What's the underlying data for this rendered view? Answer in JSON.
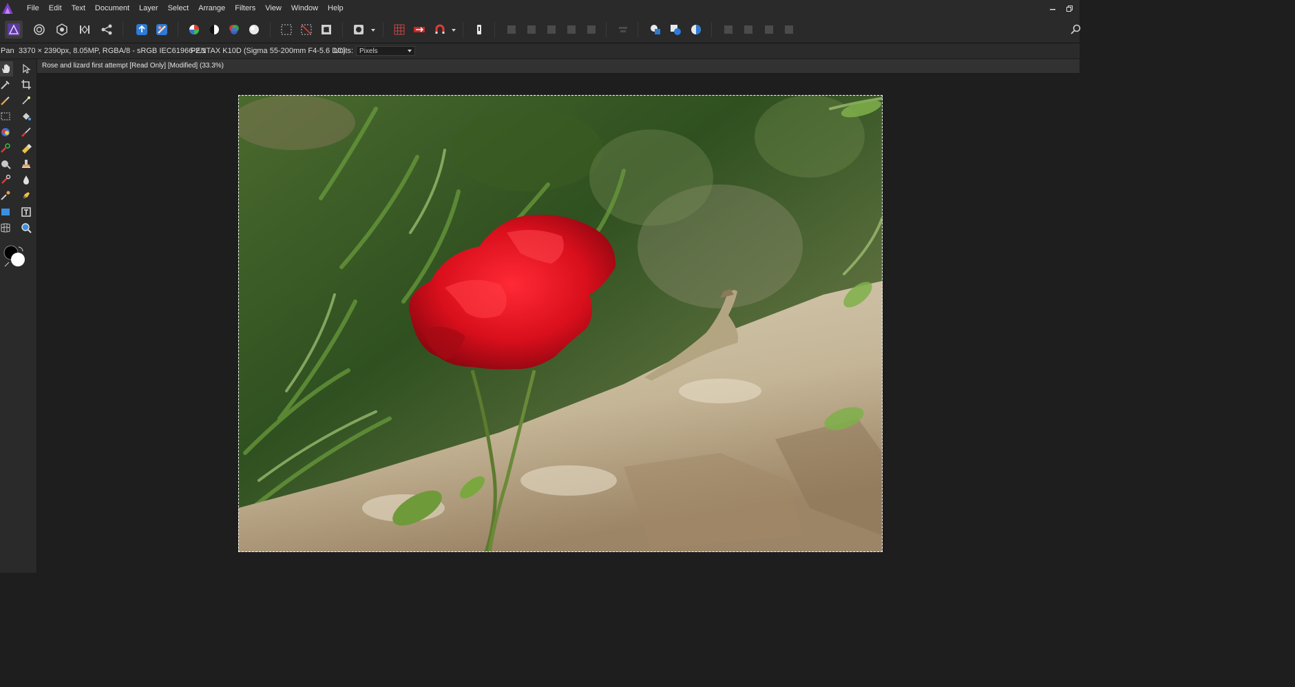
{
  "menu": {
    "items": [
      "File",
      "Edit",
      "Text",
      "Document",
      "Layer",
      "Select",
      "Arrange",
      "Filters",
      "View",
      "Window",
      "Help"
    ]
  },
  "toolbar": {
    "personas": [
      "photo-persona-icon",
      "liquify-persona-icon",
      "develop-persona-icon",
      "tone-mapping-persona-icon",
      "export-persona-icon"
    ],
    "groups": [
      "share-icon",
      "auto-levels-icon",
      "auto-contrast-icon",
      "auto-colour-icon",
      "auto-white-balance-icon"
    ]
  },
  "context": {
    "tool_name": "Pan",
    "doc_info": "3370 × 2390px, 8.05MP, RGBA/8 - sRGB IEC61966-2.1",
    "camera": "PENTAX K10D (Sigma 55-200mm F4-5.6 DC)",
    "units_label": "Units:",
    "units_value": "Pixels"
  },
  "document": {
    "tab_title": "Rose and lizard first attempt [Read Only] [Modified] (33.3%)"
  },
  "colors": {
    "accent": "#2d7bd6",
    "rose": "#d9101c",
    "foliage": "#3e6b2a",
    "rock": "#cbbfa6"
  }
}
